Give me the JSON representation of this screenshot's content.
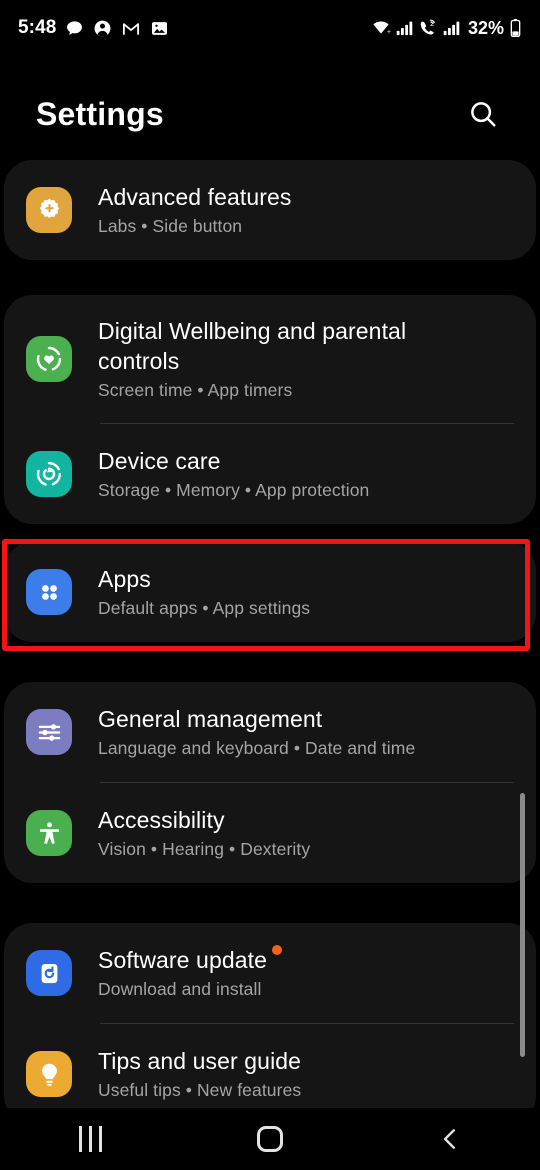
{
  "status_bar": {
    "time": "5:48",
    "battery_percent": "32%",
    "left_icons": [
      "message-bubble-icon",
      "contact-person-icon",
      "gmail-icon",
      "photos-icon"
    ],
    "right_icons": [
      "wifi-icon",
      "signal-bars-icon",
      "call-sim2-icon",
      "signal-bars-2-icon",
      "battery-icon"
    ]
  },
  "header": {
    "title": "Settings",
    "search_icon": "search-icon"
  },
  "cards": [
    {
      "rows": [
        {
          "title": "Advanced features",
          "subtitle": "Labs  •  Side button",
          "icon": "gear-plus-icon",
          "icon_color": "#E0A53C",
          "badge": false
        }
      ]
    },
    {
      "rows": [
        {
          "title": "Digital Wellbeing and parental controls",
          "subtitle": "Screen time  •  App timers",
          "icon": "heart-circle-icon",
          "icon_color": "#4CAF50",
          "badge": false
        },
        {
          "title": "Device care",
          "subtitle": "Storage  •  Memory  •  App protection",
          "icon": "device-care-spiral-icon",
          "icon_color": "#11B5A0",
          "badge": false
        }
      ]
    },
    {
      "rows": [
        {
          "title": "Apps",
          "subtitle": "Default apps  •  App settings",
          "icon": "four-dots-apps-icon",
          "icon_color": "#3C7DEA",
          "badge": false
        }
      ]
    },
    {
      "rows": [
        {
          "title": "General management",
          "subtitle": "Language and keyboard  •  Date and time",
          "icon": "sliders-icon",
          "icon_color": "#7B7DC0",
          "badge": false
        },
        {
          "title": "Accessibility",
          "subtitle": "Vision  •  Hearing  •  Dexterity",
          "icon": "accessibility-person-icon",
          "icon_color": "#4BAE4F",
          "badge": false
        }
      ]
    },
    {
      "rows": [
        {
          "title": "Software update",
          "subtitle": "Download and install",
          "icon": "software-update-icon",
          "icon_color": "#2F6BE5",
          "badge": true,
          "badge_color": "#F4611A"
        },
        {
          "title": "Tips and user guide",
          "subtitle": "Useful tips  •  New features",
          "icon": "lightbulb-icon",
          "icon_color": "#EDAA33",
          "badge": false
        }
      ]
    }
  ],
  "annotation": {
    "color": "#f31414",
    "target": "Apps"
  },
  "nav_bar": {
    "recents_label": "recents-button",
    "home_label": "home-button",
    "back_label": "back-button"
  }
}
